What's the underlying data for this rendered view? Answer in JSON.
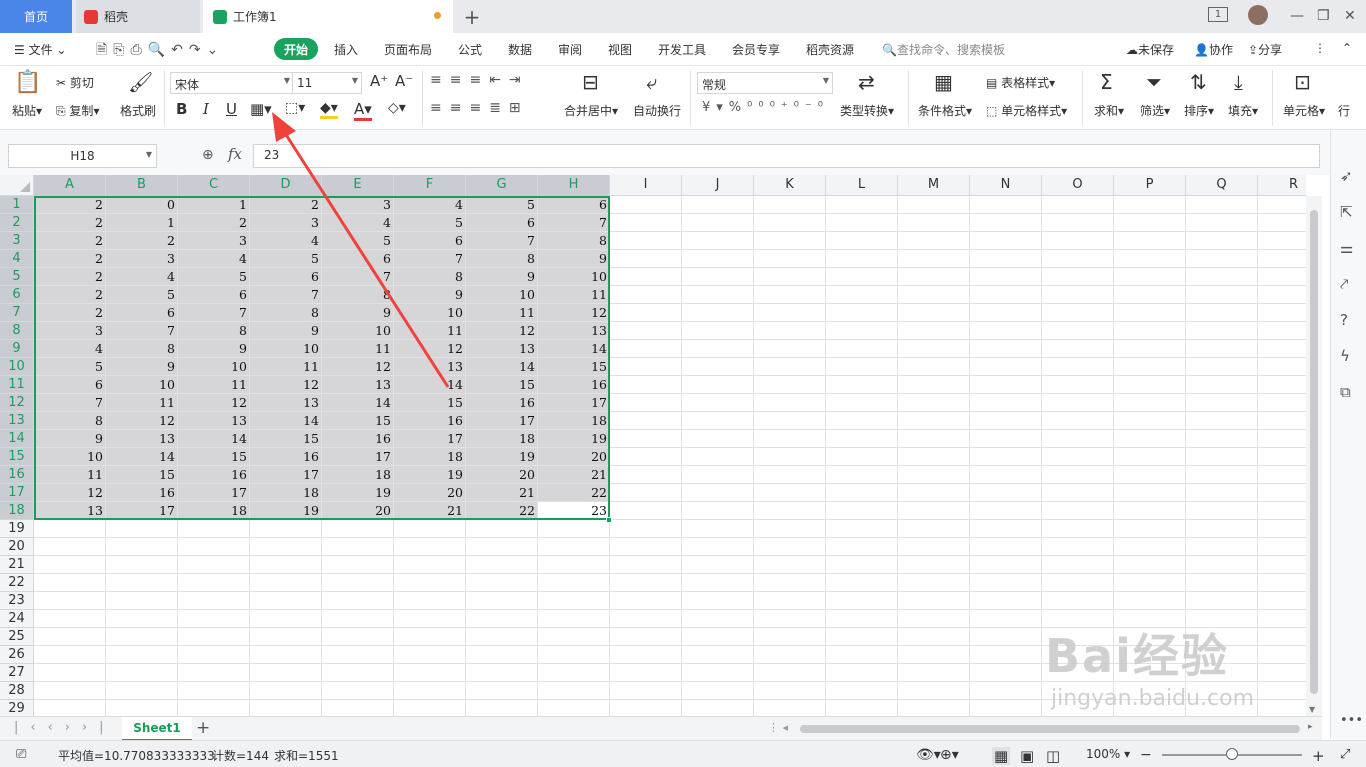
{
  "titlebar": {
    "tabs": [
      {
        "label": "首页"
      },
      {
        "label": "稻壳"
      },
      {
        "label": "工作簿1"
      }
    ],
    "page_badge": "1"
  },
  "menu": {
    "file": "文件",
    "items": [
      "开始",
      "插入",
      "页面布局",
      "公式",
      "数据",
      "审阅",
      "视图",
      "开发工具",
      "会员专享",
      "稻壳资源"
    ],
    "search_placeholder": "查找命令、搜索模板",
    "unsaved": "未保存",
    "collab": "协作",
    "share": "分享"
  },
  "ribbon": {
    "paste": "粘贴",
    "cut": "剪切",
    "copy": "复制",
    "format_painter": "格式刷",
    "font_name": "宋体",
    "font_size": "11",
    "merge_center": "合并居中",
    "wrap": "自动换行",
    "number_format": "常规",
    "type_convert": "类型转换",
    "cond_format": "条件格式",
    "table_style": "表格样式",
    "cell_style": "单元格样式",
    "sum": "求和",
    "filter": "筛选",
    "sort": "排序",
    "fill": "填充",
    "cell": "单元格",
    "row_col": "行"
  },
  "formula_bar": {
    "name_box": "H18",
    "fx": "fx",
    "value": "23"
  },
  "grid": {
    "columns": [
      "A",
      "B",
      "C",
      "D",
      "E",
      "F",
      "G",
      "H",
      "I",
      "J",
      "K",
      "L",
      "M",
      "N",
      "O",
      "P",
      "Q",
      "R"
    ],
    "rows": [
      "1",
      "2",
      "3",
      "4",
      "5",
      "6",
      "7",
      "8",
      "9",
      "10",
      "11",
      "12",
      "13",
      "14",
      "15",
      "16",
      "17",
      "18",
      "19",
      "20",
      "21",
      "22",
      "23",
      "24",
      "25",
      "26",
      "27",
      "28",
      "29"
    ],
    "data": [
      [
        "2",
        "0",
        "1",
        "2",
        "3",
        "4",
        "5",
        "6"
      ],
      [
        "2",
        "1",
        "2",
        "3",
        "4",
        "5",
        "6",
        "7"
      ],
      [
        "2",
        "2",
        "3",
        "4",
        "5",
        "6",
        "7",
        "8"
      ],
      [
        "2",
        "3",
        "4",
        "5",
        "6",
        "7",
        "8",
        "9"
      ],
      [
        "2",
        "4",
        "5",
        "6",
        "7",
        "8",
        "9",
        "10"
      ],
      [
        "2",
        "5",
        "6",
        "7",
        "8",
        "9",
        "10",
        "11"
      ],
      [
        "2",
        "6",
        "7",
        "8",
        "9",
        "10",
        "11",
        "12"
      ],
      [
        "3",
        "7",
        "8",
        "9",
        "10",
        "11",
        "12",
        "13"
      ],
      [
        "4",
        "8",
        "9",
        "10",
        "11",
        "12",
        "13",
        "14"
      ],
      [
        "5",
        "9",
        "10",
        "11",
        "12",
        "13",
        "14",
        "15"
      ],
      [
        "6",
        "10",
        "11",
        "12",
        "13",
        "14",
        "15",
        "16"
      ],
      [
        "7",
        "11",
        "12",
        "13",
        "14",
        "15",
        "16",
        "17"
      ],
      [
        "8",
        "12",
        "13",
        "14",
        "15",
        "16",
        "17",
        "18"
      ],
      [
        "9",
        "13",
        "14",
        "15",
        "16",
        "17",
        "18",
        "19"
      ],
      [
        "10",
        "14",
        "15",
        "16",
        "17",
        "18",
        "19",
        "20"
      ],
      [
        "11",
        "15",
        "16",
        "17",
        "18",
        "19",
        "20",
        "21"
      ],
      [
        "12",
        "16",
        "17",
        "18",
        "19",
        "20",
        "21",
        "22"
      ],
      [
        "13",
        "17",
        "18",
        "19",
        "20",
        "21",
        "22",
        "23"
      ]
    ]
  },
  "sheets": {
    "tabs": [
      "Sheet1"
    ]
  },
  "status": {
    "average": "平均值=10.770833333333",
    "count": "计数=144",
    "sum": "求和=1551",
    "zoom": "100%"
  },
  "watermark": {
    "line1": "Bai经验",
    "line2": "jingyan.baidu.com"
  },
  "colors": {
    "accent": "#1aa35f",
    "home_tab": "#4a86e8",
    "annotation_arrow": "#f0423d"
  }
}
